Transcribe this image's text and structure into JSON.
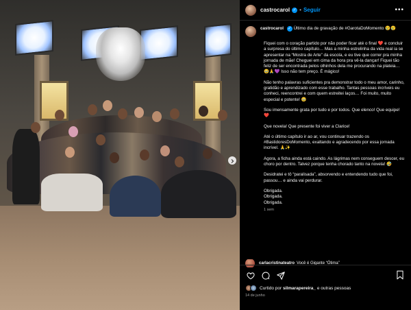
{
  "post": {
    "username": "castrocarol",
    "follow_label": "Seguir",
    "separator": "•",
    "caption_username": "castrocarol",
    "caption_lines": [
      "Último dia de gravação de #GarotaDoMomento 😢😢",
      "Fiquei com o coração partido por não poder ficar até o final ❤️ e concluir a surpresa do último capítulo… Mas a minha estrelinha da vida real ia se apresentar na “Mostra de Arte” da escola, e eu tive que correr pra minha jornada de mãe! Cheguei em cima da hora pra vê-la dançar! Fiquei tão feliz de ser encontrada pelos olhinhos dela me procurando na plateia… 🥹🙏💜 Isso não tem preço. É mágico!",
      "Não tenho palavras suficientes pra demonstrar todo o meu amor, carinho, gratidão e aprendizado com esse trabalho. Tantas pessoas incríveis eu conheci, reencontrei e com quem estreitei laços… Foi muito, muito especial e potente! 🥹",
      "Sou imensamente grata por tudo e por todos. Que elenco! Que equipe! ❤️",
      "Que novela! Que presente foi viver a Clarice!",
      "Até o último capítulo ir ao ar, vou continuar trazendo os #BastidoresDoMomento, exaltando e agradecendo por essa jornada incrível. 🙏✨",
      "Agora, a ficha ainda está caindo. As lágrimas nem conseguem descer, eu choro por dentro. Talvez porque tenha chorado tanto na novela! 🤣",
      "Desidratei e tô “paralisada”, absorvendo e entendendo tudo que foi, passou… e ainda vai perdurar.",
      "Obrigada.",
      "Obrigada.",
      "Obrigada."
    ],
    "time_ago": "1 sem"
  },
  "comment": {
    "username": "carlacristinateatro",
    "text": "Você é Gigante “Ótima”"
  },
  "likes": {
    "prefix": "Curtido por",
    "user": "silmarapereira_",
    "suffix": "e outras pessoas"
  },
  "date": "14 de junho",
  "icons": [
    "heart-icon",
    "comment-icon",
    "share-icon",
    "bookmark-icon",
    "more-icon",
    "verified-icon",
    "next-slide-icon"
  ]
}
